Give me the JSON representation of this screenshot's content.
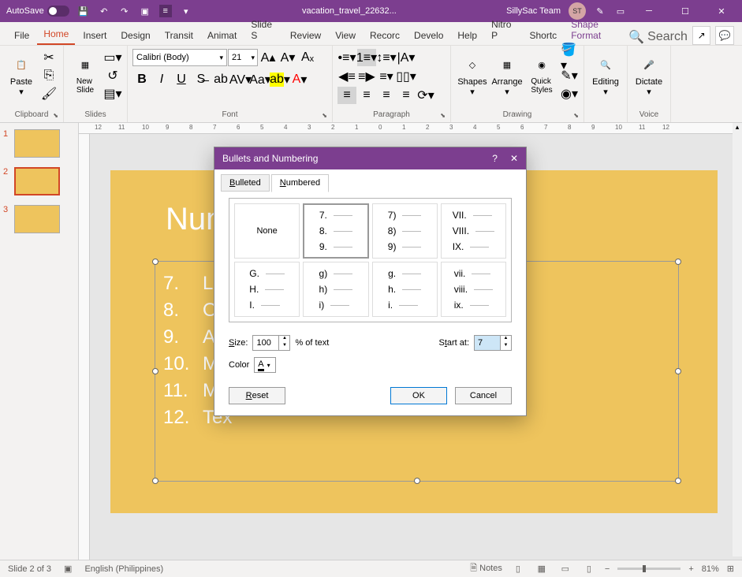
{
  "titlebar": {
    "autosave_label": "AutoSave",
    "autosave_state": "Off",
    "filename": "vacation_travel_22632...",
    "team": "SillySac Team",
    "team_initials": "ST"
  },
  "tabs": {
    "file": "File",
    "home": "Home",
    "insert": "Insert",
    "design": "Design",
    "transitions": "Transit",
    "animations": "Animat",
    "slideshow": "Slide S",
    "review": "Review",
    "view": "View",
    "recording": "Recorc",
    "developer": "Develo",
    "help": "Help",
    "nitro": "Nitro P",
    "shortcut": "Shortc",
    "shape_format": "Shape Format",
    "search": "Search"
  },
  "ribbon": {
    "clipboard": {
      "label": "Clipboard",
      "paste": "Paste"
    },
    "slides": {
      "label": "Slides",
      "new_slide": "New\nSlide"
    },
    "font": {
      "label": "Font",
      "name": "Calibri (Body)",
      "size": "21"
    },
    "paragraph": {
      "label": "Paragraph"
    },
    "drawing": {
      "label": "Drawing",
      "shapes": "Shapes",
      "arrange": "Arrange",
      "quick_styles": "Quick\nStyles"
    },
    "editing": {
      "label": "Editing",
      "btn": "Editing"
    },
    "voice": {
      "label": "Voice",
      "dictate": "Dictate"
    }
  },
  "slide_panel": {
    "slides": [
      {
        "num": "1"
      },
      {
        "num": "2"
      },
      {
        "num": "3"
      }
    ]
  },
  "slide_content": {
    "title": "Num",
    "items": [
      {
        "num": "7.",
        "text": "Lou"
      },
      {
        "num": "8.",
        "text": "Okl"
      },
      {
        "num": "9.",
        "text": "Ark"
      },
      {
        "num": "10.",
        "text": "Mis"
      },
      {
        "num": "11.",
        "text": "Mir"
      },
      {
        "num": "12.",
        "text": "Tex"
      }
    ]
  },
  "dialog": {
    "title": "Bullets and Numbering",
    "tab_bulleted": "Bulleted",
    "tab_numbered": "Numbered",
    "options": {
      "none": "None",
      "opt1": [
        "7.",
        "8.",
        "9."
      ],
      "opt2": [
        "7)",
        "8)",
        "9)"
      ],
      "opt3": [
        "VII.",
        "VIII.",
        "IX."
      ],
      "opt4": [
        "G.",
        "H.",
        "I."
      ],
      "opt5": [
        "g)",
        "h)",
        "i)"
      ],
      "opt6": [
        "g.",
        "h.",
        "i."
      ],
      "opt7": [
        "vii.",
        "viii.",
        "ix."
      ]
    },
    "size_label": "Size:",
    "size_value": "100",
    "percent_text": "% of text",
    "start_label": "Start at:",
    "start_value": "7",
    "color_label": "Color",
    "reset": "Reset",
    "ok": "OK",
    "cancel": "Cancel"
  },
  "statusbar": {
    "slide_info": "Slide 2 of 3",
    "language": "English (Philippines)",
    "notes": "Notes",
    "zoom": "81%"
  },
  "ruler_marks": [
    "12",
    "11",
    "10",
    "9",
    "8",
    "7",
    "6",
    "5",
    "4",
    "3",
    "2",
    "1",
    "0",
    "1",
    "2",
    "3",
    "4",
    "5",
    "6",
    "7",
    "8",
    "9",
    "10",
    "11",
    "12"
  ]
}
